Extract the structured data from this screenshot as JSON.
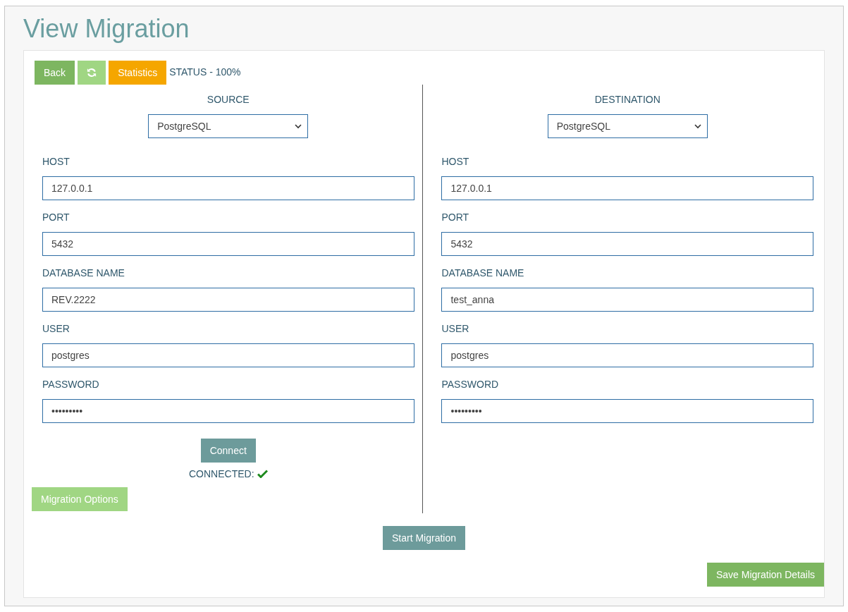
{
  "page_title": "View Migration",
  "toolbar": {
    "buttons": [
      {
        "kind": "text",
        "label": "Back",
        "color": "#7db660"
      },
      {
        "kind": "refresh",
        "color": "#a0d683"
      },
      {
        "kind": "text",
        "label": "Statistics",
        "color": "#f5a600"
      }
    ],
    "status": "STATUS - 100%"
  },
  "panels": [
    {
      "heading": "SOURCE",
      "database_type": "PostgreSQL",
      "fields": [
        {
          "label": "HOST",
          "value": "127.0.0.1"
        },
        {
          "label": "PORT",
          "value": "5432"
        },
        {
          "label": "DATABASE NAME",
          "value": "REV.2222"
        },
        {
          "label": "USER",
          "value": "postgres"
        },
        {
          "label": "PASSWORD",
          "value": "•••••••••"
        }
      ],
      "connect_button": "Connect",
      "connection_status": "CONNECTED:",
      "connected": true,
      "options_button": "Migration Options"
    },
    {
      "heading": "DESTINATION",
      "database_type": "PostgreSQL",
      "fields": [
        {
          "label": "HOST",
          "value": "127.0.0.1"
        },
        {
          "label": "PORT",
          "value": "5432"
        },
        {
          "label": "DATABASE NAME",
          "value": "test_anna"
        },
        {
          "label": "USER",
          "value": "postgres"
        },
        {
          "label": "PASSWORD",
          "value": "•••••••••"
        }
      ]
    }
  ],
  "start_button": "Start Migration",
  "save_button": "Save Migration Details"
}
